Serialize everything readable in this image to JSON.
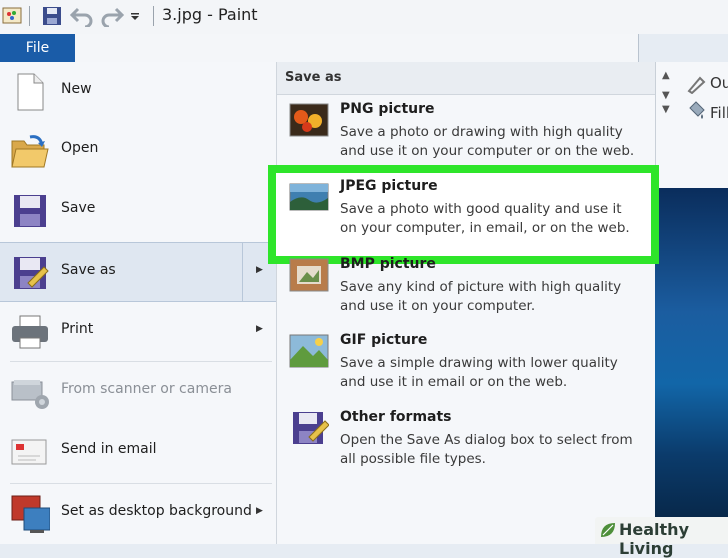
{
  "window": {
    "title": "3.jpg - Paint",
    "file_tab": "File"
  },
  "ribbon": {
    "outline": "Ou",
    "fill": "Fill"
  },
  "menu": {
    "items": [
      {
        "label": "New",
        "icon": "new-file-icon"
      },
      {
        "label": "Open",
        "icon": "open-folder-icon"
      },
      {
        "label": "Save",
        "icon": "save-disk-icon"
      },
      {
        "label": "Save as",
        "icon": "save-as-icon",
        "active": true
      },
      {
        "label": "Print",
        "icon": "printer-icon"
      },
      {
        "label": "From scanner or camera",
        "icon": "scanner-icon",
        "disabled": true
      },
      {
        "label": "Send in email",
        "icon": "email-icon"
      },
      {
        "label": "Set as desktop background",
        "icon": "desktop-background-icon"
      }
    ]
  },
  "save_as": {
    "header": "Save as",
    "options": [
      {
        "title": "PNG picture",
        "desc": "Save a photo or drawing with high quality and use it on your computer or on the web."
      },
      {
        "title": "JPEG picture",
        "desc": "Save a photo with good quality and use it on your computer, in email, or on the web."
      },
      {
        "title": "BMP picture",
        "desc": "Save any kind of picture with high quality and use it on your computer."
      },
      {
        "title": "GIF picture",
        "desc": "Save a simple drawing with lower quality and use it in email or on the web."
      },
      {
        "title": "Other formats",
        "desc": "Open the Save As dialog box to select from all possible file types."
      }
    ]
  },
  "watermark": "Healthy Living",
  "colors": {
    "file_tab": "#1a5ca8",
    "highlight_border": "#2ee52a"
  }
}
